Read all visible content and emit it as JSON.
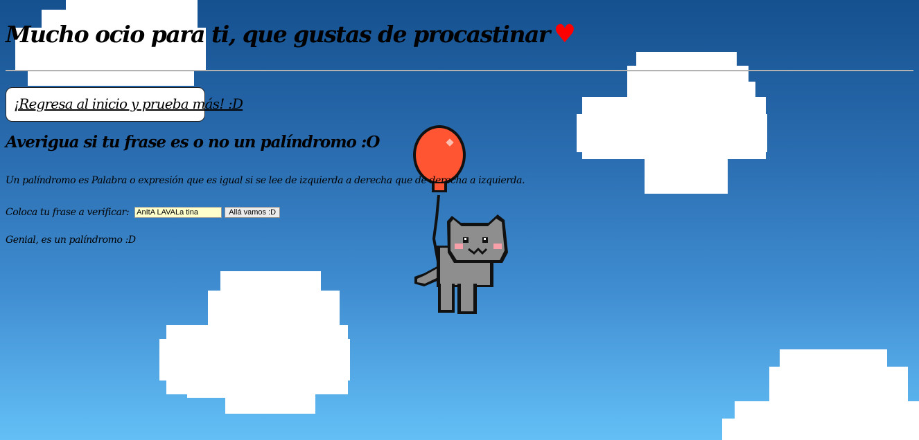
{
  "header": {
    "title": "Mucho ocio para ti, que gustas de procastinar",
    "heart_icon": "♥"
  },
  "nav": {
    "home_link": "¡Regresa al inicio y prueba más! :D"
  },
  "main": {
    "section_title": "Averigua si tu frase es o no un palíndromo :O",
    "definition": "Un palíndromo es Palabra o expresión que es igual si se lee de izquierda a derecha que de derecha a izquierda.",
    "form": {
      "label": "Coloca tu frase a verificar:",
      "input_value": "AnItA LAVALa tina",
      "submit_label": "Allá vamos :D"
    },
    "result": "Genial, es un palíndromo :D"
  },
  "background": {
    "sky_colors": [
      "#15508f",
      "#63bff6"
    ],
    "cloud_color": "#ffffff",
    "balloon_color": "#ff5533",
    "cat_color": "#8e8e8e",
    "icons": [
      "cloud-icon",
      "balloon-icon",
      "pixel-cat-icon"
    ]
  }
}
